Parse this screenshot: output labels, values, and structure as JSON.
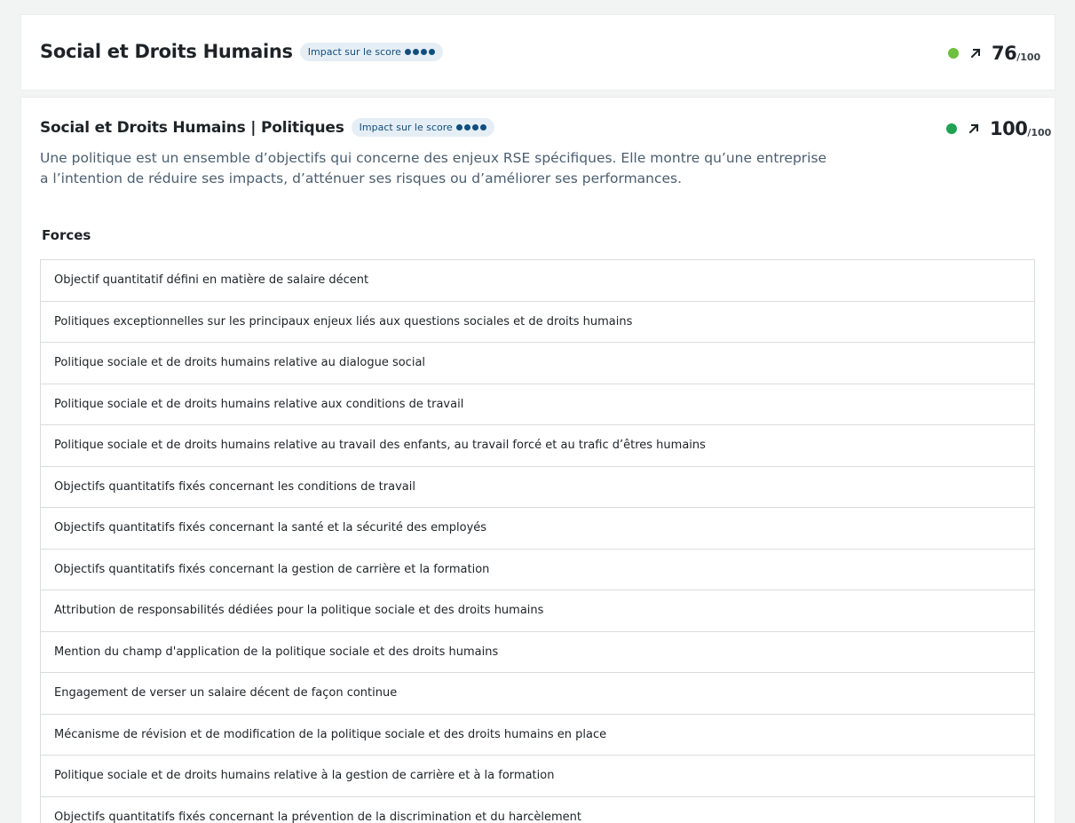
{
  "section": {
    "title": "Social et Droits Humains",
    "impact_label": "Impact sur le score",
    "impact_level": 4,
    "status_color": "#6fbf40",
    "trend": "arrow-up-right-icon",
    "score": "76",
    "score_max": "/100"
  },
  "subsection": {
    "title": "Social et Droits Humains | Politiques",
    "impact_label": "Impact sur le score",
    "impact_level": 4,
    "status_color": "#1fa352",
    "trend": "arrow-up-right-icon",
    "score": "100",
    "score_max": "/100",
    "description": "Une politique est un ensemble d’objectifs qui concerne des enjeux RSE spécifiques. Elle montre qu’une entreprise a l’intention de réduire ses impacts, d’atténuer ses risques ou d’améliorer ses performances."
  },
  "forces": {
    "title": "Forces",
    "items": [
      "Objectif quantitatif défini en matière de salaire décent",
      "Politiques exceptionnelles sur les principaux enjeux liés aux questions sociales et de droits humains",
      "Politique sociale et de droits humains relative au dialogue social",
      "Politique sociale et de droits humains relative aux conditions de travail",
      "Politique sociale et de droits humains relative au travail des enfants, au travail forcé et au trafic d’êtres humains",
      "Objectifs quantitatifs fixés concernant les conditions de travail",
      "Objectifs quantitatifs fixés concernant la santé et la sécurité des employés",
      "Objectifs quantitatifs fixés concernant la gestion de carrière et la formation",
      "Attribution de responsabilités dédiées pour la politique sociale et des droits humains",
      "Mention du champ d'application de la politique sociale et des droits humains",
      "Engagement de verser un salaire décent de façon continue",
      "Mécanisme de révision et de modification de la politique sociale et des droits humains en place",
      "Politique sociale et de droits humains relative à la gestion de carrière et à la formation",
      "Objectifs quantitatifs fixés concernant la prévention de la discrimination et du harcèlement"
    ]
  }
}
